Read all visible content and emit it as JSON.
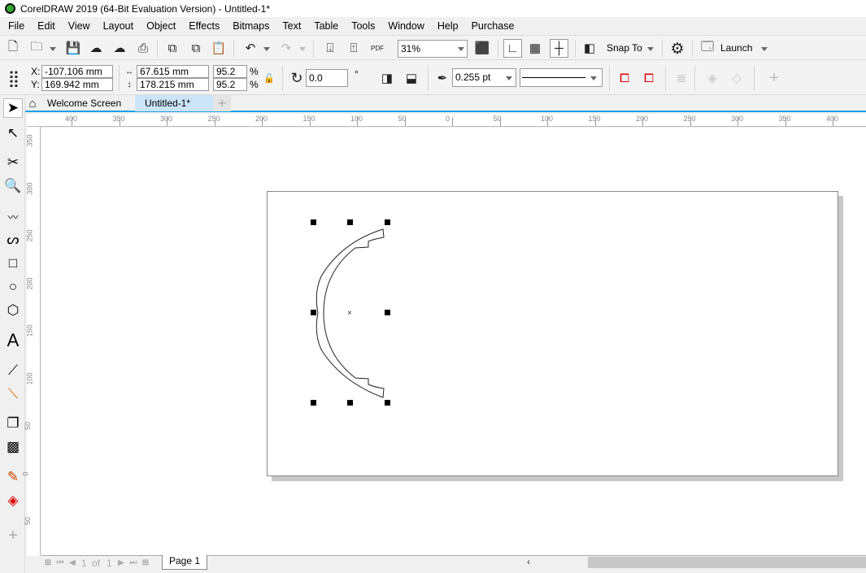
{
  "title": "CorelDRAW 2019 (64-Bit Evaluation Version) - Untitled-1*",
  "menu": [
    "File",
    "Edit",
    "View",
    "Layout",
    "Object",
    "Effects",
    "Bitmaps",
    "Text",
    "Table",
    "Tools",
    "Window",
    "Help",
    "Purchase"
  ],
  "toolbar": {
    "zoom": "31%",
    "snap_to": "Snap To",
    "launch": "Launch",
    "pdf": "PDF"
  },
  "propbar": {
    "x_label": "X:",
    "y_label": "Y:",
    "x": "-107.106 mm",
    "y": "169.942 mm",
    "width": "67.615 mm",
    "height": "178.215 mm",
    "scale_x": "95.2",
    "scale_y": "95.2",
    "pct": "%",
    "rotation": "0.0",
    "degree": "°",
    "outline_width": "0.255 pt"
  },
  "tabs": {
    "welcome": "Welcome Screen",
    "doc": "Untitled-1*",
    "add": "+"
  },
  "rulers": {
    "h_labels": [
      "400",
      "350",
      "300",
      "250",
      "200",
      "150",
      "100",
      "50",
      "0",
      "50",
      "100",
      "150",
      "200",
      "250",
      "300",
      "350",
      "400"
    ],
    "v_labels": [
      "350",
      "300",
      "250",
      "200",
      "150",
      "100",
      "50",
      "0",
      "50"
    ]
  },
  "pagenav": {
    "current": "1",
    "of": "of",
    "total": "1",
    "page_tab": "Page 1"
  },
  "colors": {
    "accent": "#1ba1e2",
    "tab_active": "#cce4f7"
  }
}
